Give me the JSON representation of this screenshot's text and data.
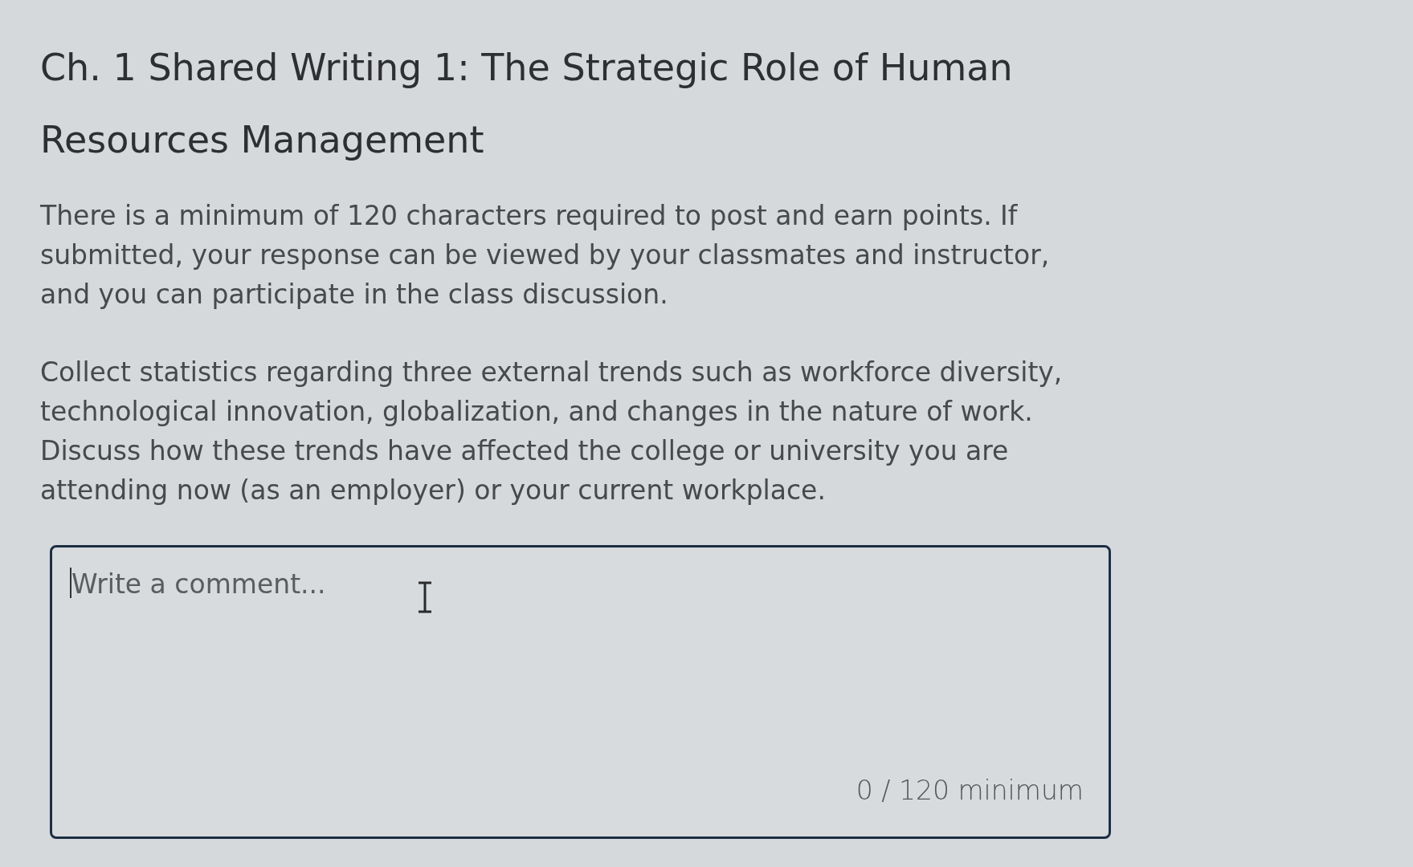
{
  "title": "Ch. 1 Shared Writing 1: The Strategic Role of Human Resources Management",
  "paragraphs": [
    "There is a minimum of 120 characters required to post and earn points. If submitted, your response can be viewed by your classmates and instructor, and you can participate in the class discussion.",
    "Collect statistics regarding three external trends such as workforce diversity, technological innovation, globalization, and changes in the nature of work. Discuss how these trends have affected the college or university you are attending now (as an employer) or your current workplace."
  ],
  "comment_box": {
    "placeholder": "Write a comment...",
    "focused": true,
    "counter": "0 / 120 minimum"
  }
}
